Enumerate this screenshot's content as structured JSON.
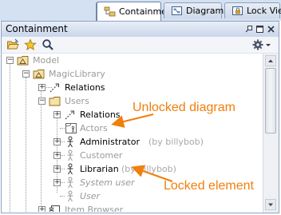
{
  "tabs": [
    {
      "label": "Containment",
      "icon": "containment-tab-icon",
      "active": true
    },
    {
      "label": "Diagrams",
      "icon": "diagrams-tab-icon",
      "active": false
    },
    {
      "label": "Lock View",
      "icon": "lock-view-tab-icon",
      "active": false
    }
  ],
  "panel": {
    "title": "Containment"
  },
  "toolbar": {
    "buttons": [
      "open-folder-icon",
      "star-icon",
      "search-icon"
    ],
    "settings": "gear-icon"
  },
  "tree": [
    {
      "label": "Model",
      "owner": "",
      "icon": "package-model-icon"
    },
    {
      "label": "MagicLibrary",
      "owner": "",
      "icon": "package-model-icon"
    },
    {
      "label": "Relations",
      "owner": "",
      "icon": "relations-icon"
    },
    {
      "label": "Users",
      "owner": "",
      "icon": "folder-icon"
    },
    {
      "label": "Relations",
      "owner": "",
      "icon": "relations-icon"
    },
    {
      "label": "Actors",
      "owner": "",
      "icon": "diagram-icon"
    },
    {
      "label": "Administrator",
      "owner": "(by billybob)",
      "icon": "actor-icon"
    },
    {
      "label": "Customer",
      "owner": "",
      "icon": "actor-icon"
    },
    {
      "label": "Librarian",
      "owner": "(by billybob)",
      "icon": "actor-icon"
    },
    {
      "label": "System user",
      "owner": "",
      "icon": "actor-icon"
    },
    {
      "label": "User",
      "owner": "",
      "icon": "actor-icon"
    },
    {
      "label": "Item Browser",
      "owner": "",
      "icon": "component-icon"
    }
  ],
  "callouts": {
    "unlocked": "Unlocked diagram",
    "locked": "Locked element"
  },
  "colors": {
    "callout": "#f07f0c",
    "accent": "#8fa3c1"
  }
}
